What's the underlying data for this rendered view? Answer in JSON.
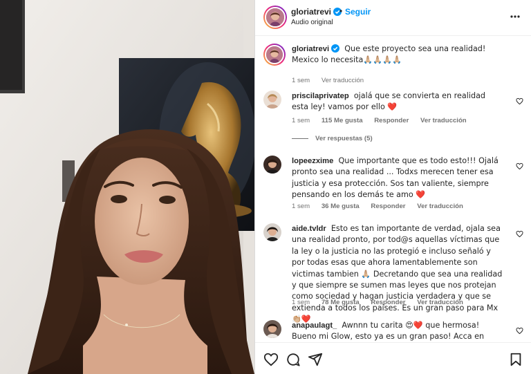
{
  "post": {
    "username": "gloriatrevi",
    "separator": "•",
    "follow_label": "Seguir",
    "audio_label": "Audio original"
  },
  "caption": {
    "username": "gloriatrevi",
    "text": "Que este proyecto sea una realidad! Mexico lo necesita🙏🏼🙏🏼🙏🏼🙏🏼",
    "time": "1 sem",
    "translate": "Ver traducción"
  },
  "comments": [
    {
      "username": "priscilaprivatep",
      "text": "ojalá que se convierta en realidad esta ley! vamos por ello ❤️",
      "time": "1 sem",
      "likes": "115 Me gusta",
      "reply": "Responder",
      "translate": "Ver traducción",
      "replies_label": "Ver respuestas (5)"
    },
    {
      "username": "lopeezxime",
      "text": "Que importante que es todo esto!!! Ojalá pronto sea una realidad ... Todxs merecen tener esa justicia y esa protección. Sos tan valiente, siempre pensando en los demás te amo ❤️",
      "time": "1 sem",
      "likes": "36 Me gusta",
      "reply": "Responder",
      "translate": "Ver traducción"
    },
    {
      "username": "aide.tvldr",
      "text": "Esto es tan importante de verdad, ojala sea una realidad pronto, por tod@s aquellas víctimas que la ley o la justicia no las protegió e incluso señaló y por todas esas que ahora lamentablemente son victimas tambien 🙏🏼 Decretando que sea una realidad y que siempre se sumen mas leyes que nos protejan como sociedad y hagan justicia verdadera y que se extienda a todos los paises. Es un gran paso para Mx 👏🏼❤️",
      "time": "1 sem",
      "likes": "78 Me gusta",
      "reply": "Responder",
      "translate": "Ver traducción"
    },
    {
      "username": "anapaulagt_",
      "text": "Awnnn tu carita 😍❤️ que hermosa! Bueno mi Glow, esto ya es un gran paso! Acca en Brasil pasa muchisimo"
    }
  ],
  "colors": {
    "accent": "#0095f6",
    "text": "#262626",
    "muted": "#737373",
    "heart": "#ed1d24"
  },
  "icons": [
    "verified-badge-icon",
    "more-options-icon",
    "heart-icon",
    "comment-icon",
    "share-icon",
    "bookmark-icon"
  ]
}
